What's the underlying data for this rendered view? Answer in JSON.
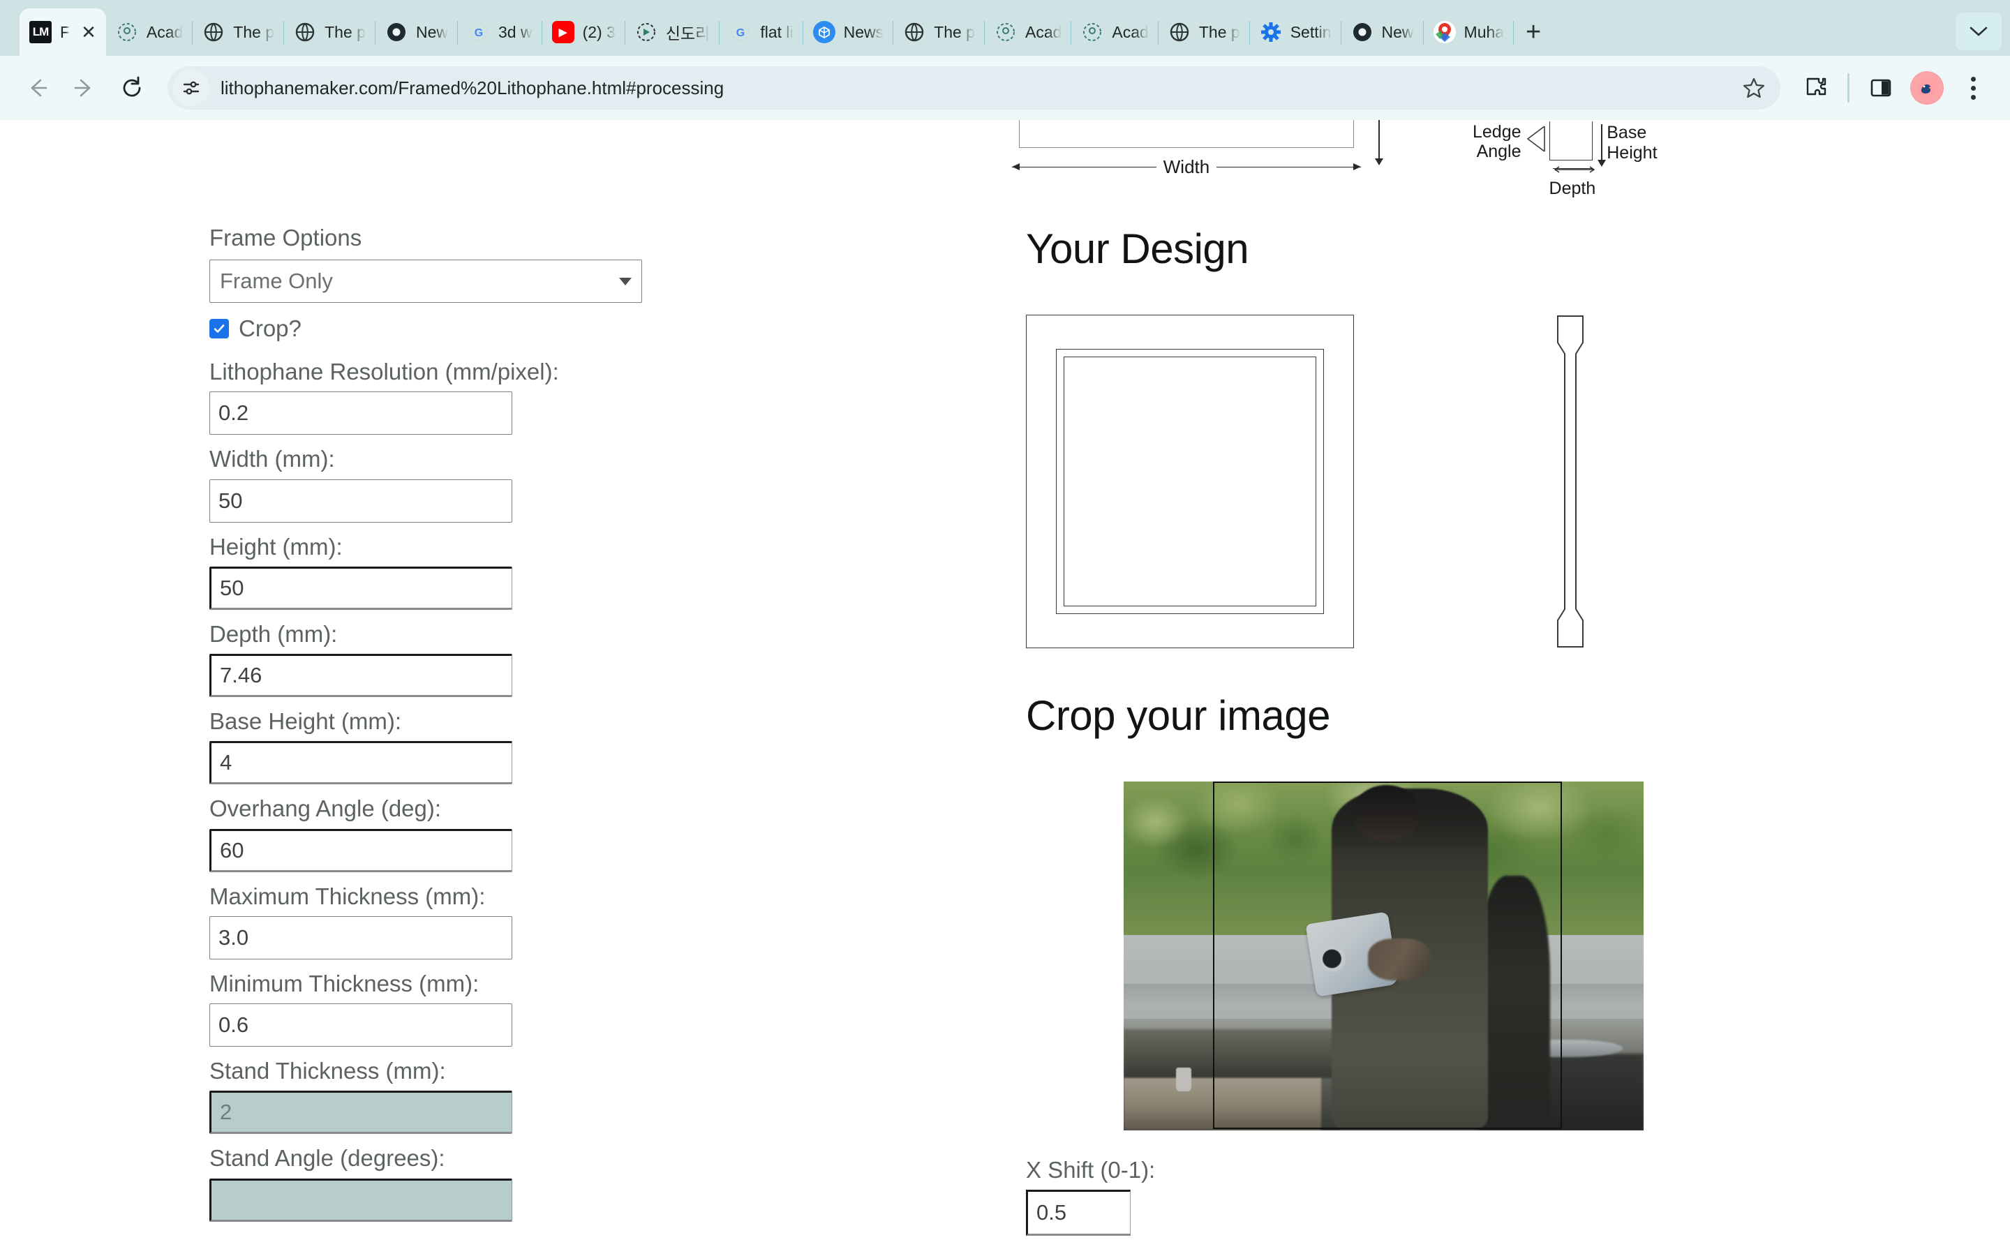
{
  "browser": {
    "tabs": [
      {
        "label": "F",
        "favicon": "lm-icon",
        "active": true,
        "has_close": true
      },
      {
        "label": "Acad",
        "favicon": "academia-icon",
        "active": false
      },
      {
        "label": "The p",
        "favicon": "globe-icon",
        "active": false
      },
      {
        "label": "The p",
        "favicon": "globe-icon",
        "active": false
      },
      {
        "label": "New",
        "favicon": "chrome-icon",
        "active": false
      },
      {
        "label": "3d w",
        "favicon": "google-icon",
        "active": false
      },
      {
        "label": "(2) 3",
        "favicon": "youtube-icon",
        "active": false
      },
      {
        "label": "신도리",
        "favicon": "drive-icon",
        "active": false
      },
      {
        "label": "flat li",
        "favicon": "google-icon",
        "active": false
      },
      {
        "label": "News",
        "favicon": "news-icon",
        "active": false
      },
      {
        "label": "The p",
        "favicon": "globe-icon",
        "active": false
      },
      {
        "label": "Acad",
        "favicon": "academia-icon",
        "active": false
      },
      {
        "label": "Acad",
        "favicon": "academia-icon",
        "active": false
      },
      {
        "label": "The p",
        "favicon": "globe-icon",
        "active": false
      },
      {
        "label": "Settin",
        "favicon": "gear-icon",
        "active": false
      },
      {
        "label": "New",
        "favicon": "chrome-icon",
        "active": false
      },
      {
        "label": "Muha",
        "favicon": "maps-icon",
        "active": false
      }
    ],
    "new_tab_label": "+",
    "tab_close_label": "✕",
    "url": "lithophanemaker.com/Framed%20Lithophane.html#processing",
    "toolbar_icons": [
      "back-icon",
      "forward-icon",
      "reload-icon",
      "site-info-icon",
      "bookmark-star-icon",
      "extensions-icon",
      "side-panel-icon",
      "profile-avatar",
      "chrome-menu-icon"
    ]
  },
  "form": {
    "frame_options": {
      "label": "Frame Options",
      "value": "Frame Only"
    },
    "crop": {
      "label": "Crop?",
      "checked": true
    },
    "fields": [
      {
        "label": "Lithophane Resolution (mm/pixel):",
        "value": "0.2",
        "state": "normal"
      },
      {
        "label": "Width (mm):",
        "value": "50",
        "state": "normal"
      },
      {
        "label": "Height (mm):",
        "value": "50",
        "state": "focus"
      },
      {
        "label": "Depth (mm):",
        "value": "7.46",
        "state": "focus"
      },
      {
        "label": "Base Height (mm):",
        "value": "4",
        "state": "focus"
      },
      {
        "label": "Overhang Angle (deg):",
        "value": "60",
        "state": "focus"
      },
      {
        "label": "Maximum Thickness (mm):",
        "value": "3.0",
        "state": "normal"
      },
      {
        "label": "Minimum Thickness (mm):",
        "value": "0.6",
        "state": "normal"
      },
      {
        "label": "Stand Thickness (mm):",
        "value": "2",
        "state": "selected"
      },
      {
        "label": "Stand Angle (degrees):",
        "value": "",
        "state": "selected"
      }
    ]
  },
  "diagram": {
    "width_label": "Width",
    "ledge_angle_label_line1": "Ledge",
    "ledge_angle_label_line2": "Angle",
    "depth_label": "Depth",
    "base_height_label_line1": "Base",
    "base_height_label_line2": "Height"
  },
  "sections": {
    "your_design_title": "Your Design",
    "crop_image_title": "Crop your image"
  },
  "crop_controls": {
    "x_shift_label": "X Shift (0-1):",
    "x_shift_value": "0.5"
  },
  "colors": {
    "tabstrip_bg": "#cfe3e4",
    "toolbar_bg": "#eef8f8",
    "omnibox_bg": "#e3edf1",
    "selected_field_bg": "#b6cdcb",
    "checkbox_blue": "#1a73e8",
    "label_gray": "#5c6264"
  }
}
